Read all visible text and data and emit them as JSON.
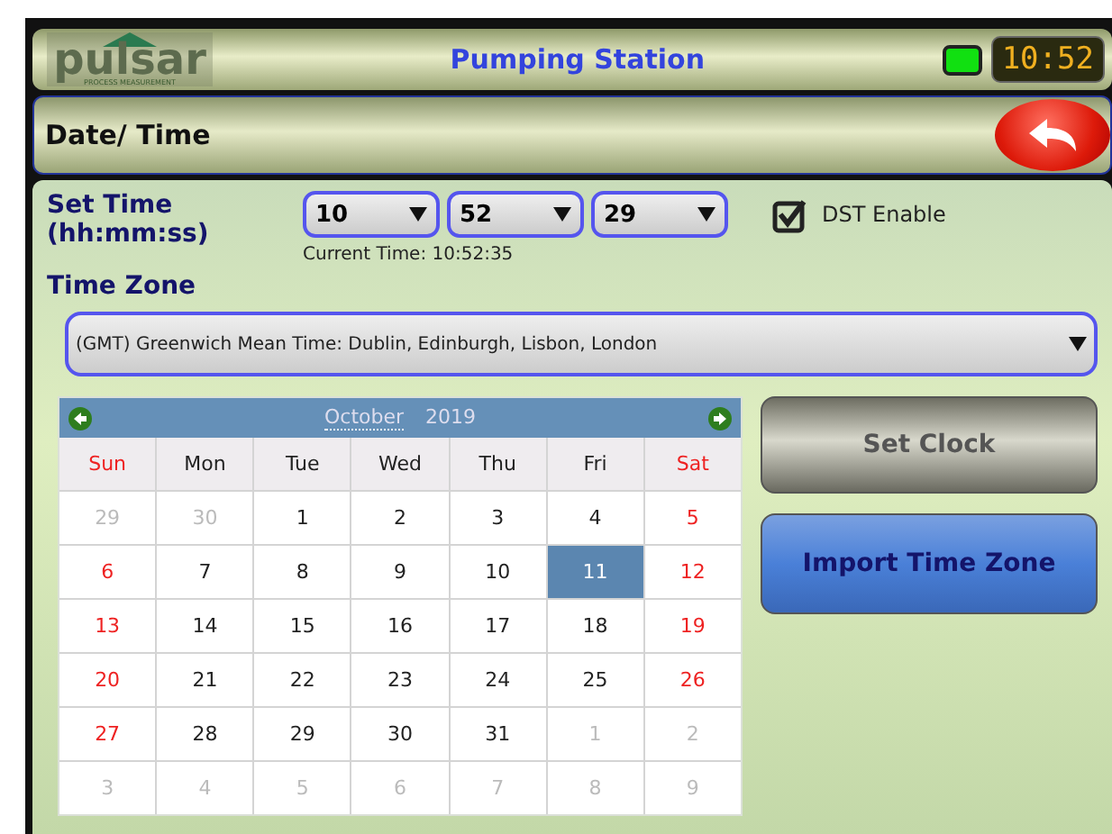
{
  "header": {
    "logo": "pulsar",
    "logo_tagline": "PROCESS MEASUREMENT",
    "title": "Pumping Station",
    "status_led": {
      "on": true
    },
    "clock": "10:52"
  },
  "page": {
    "title": "Date/ Time"
  },
  "set_time": {
    "label": "Set Time",
    "format": "(hh:mm:ss)",
    "fields": [
      {
        "value": "10"
      },
      {
        "value": "52"
      },
      {
        "value": "29"
      }
    ],
    "current_time": "Current Time: 10:52:35"
  },
  "dst": {
    "label": "DST Enable",
    "checked": true
  },
  "time_zone": {
    "label": "Time Zone",
    "value": "(GMT) Greenwich Mean Time: Dublin, Edinburgh, Lisbon, London"
  },
  "calendar": {
    "month": "October",
    "year": "2019",
    "weekdays": [
      "Sun",
      "Mon",
      "Tue",
      "Wed",
      "Thu",
      "Fri",
      "Sat"
    ],
    "weeks": [
      [
        {
          "day": "29",
          "in_month": false,
          "selected": false
        },
        {
          "day": "30",
          "in_month": false,
          "selected": false
        },
        {
          "day": "1",
          "in_month": true,
          "selected": false
        },
        {
          "day": "2",
          "in_month": true,
          "selected": false
        },
        {
          "day": "3",
          "in_month": true,
          "selected": false
        },
        {
          "day": "4",
          "in_month": true,
          "selected": false
        },
        {
          "day": "5",
          "in_month": true,
          "selected": false
        }
      ],
      [
        {
          "day": "6",
          "in_month": true,
          "selected": false
        },
        {
          "day": "7",
          "in_month": true,
          "selected": false
        },
        {
          "day": "8",
          "in_month": true,
          "selected": false
        },
        {
          "day": "9",
          "in_month": true,
          "selected": false
        },
        {
          "day": "10",
          "in_month": true,
          "selected": false
        },
        {
          "day": "11",
          "in_month": true,
          "selected": true
        },
        {
          "day": "12",
          "in_month": true,
          "selected": false
        }
      ],
      [
        {
          "day": "13",
          "in_month": true,
          "selected": false
        },
        {
          "day": "14",
          "in_month": true,
          "selected": false
        },
        {
          "day": "15",
          "in_month": true,
          "selected": false
        },
        {
          "day": "16",
          "in_month": true,
          "selected": false
        },
        {
          "day": "17",
          "in_month": true,
          "selected": false
        },
        {
          "day": "18",
          "in_month": true,
          "selected": false
        },
        {
          "day": "19",
          "in_month": true,
          "selected": false
        }
      ],
      [
        {
          "day": "20",
          "in_month": true,
          "selected": false
        },
        {
          "day": "21",
          "in_month": true,
          "selected": false
        },
        {
          "day": "22",
          "in_month": true,
          "selected": false
        },
        {
          "day": "23",
          "in_month": true,
          "selected": false
        },
        {
          "day": "24",
          "in_month": true,
          "selected": false
        },
        {
          "day": "25",
          "in_month": true,
          "selected": false
        },
        {
          "day": "26",
          "in_month": true,
          "selected": false
        }
      ],
      [
        {
          "day": "27",
          "in_month": true,
          "selected": false
        },
        {
          "day": "28",
          "in_month": true,
          "selected": false
        },
        {
          "day": "29",
          "in_month": true,
          "selected": false
        },
        {
          "day": "30",
          "in_month": true,
          "selected": false
        },
        {
          "day": "31",
          "in_month": true,
          "selected": false
        },
        {
          "day": "1",
          "in_month": false,
          "selected": false
        },
        {
          "day": "2",
          "in_month": false,
          "selected": false
        }
      ],
      [
        {
          "day": "3",
          "in_month": false,
          "selected": false
        },
        {
          "day": "4",
          "in_month": false,
          "selected": false
        },
        {
          "day": "5",
          "in_month": false,
          "selected": false
        },
        {
          "day": "6",
          "in_month": false,
          "selected": false
        },
        {
          "day": "7",
          "in_month": false,
          "selected": false
        },
        {
          "day": "8",
          "in_month": false,
          "selected": false
        },
        {
          "day": "9",
          "in_month": false,
          "selected": false
        }
      ]
    ]
  },
  "buttons": [
    {
      "label": "Set Clock",
      "kind": "grey"
    },
    {
      "label": "Import Time Zone",
      "kind": "blue"
    }
  ]
}
